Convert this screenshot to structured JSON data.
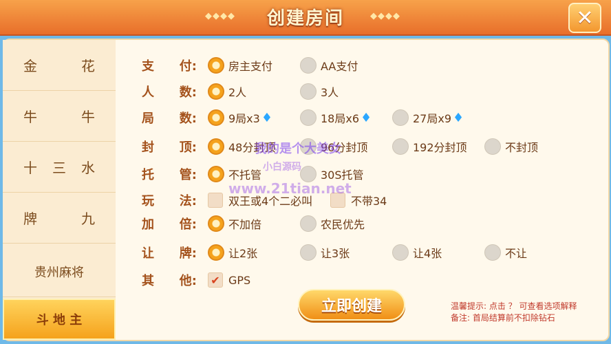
{
  "header": {
    "title": "创建房间",
    "deco_left": "◆◆◆◆",
    "deco_right": "◆◆◆◆",
    "close_glyph": "✕"
  },
  "sidebar": {
    "items": [
      {
        "a": "金",
        "b": "花"
      },
      {
        "a": "牛",
        "b": "牛"
      },
      {
        "a": "十",
        "b": "三",
        "c": "水"
      },
      {
        "a": "牌",
        "b": "九"
      },
      {
        "label": "贵州麻将"
      },
      {
        "label": "斗 地 主",
        "active": true
      }
    ]
  },
  "rows": [
    {
      "l1": "支",
      "l2": "付:",
      "options": [
        "房主支付",
        "AA支付"
      ],
      "selected": 0
    },
    {
      "l1": "人",
      "l2": "数:",
      "options": [
        "2人",
        "3人"
      ],
      "selected": 0
    },
    {
      "l1": "局",
      "l2": "数:",
      "options": [
        "9局x3",
        "18局x6",
        "27局x9"
      ],
      "selected": 0
    },
    {
      "l1": "封",
      "l2": "顶:",
      "options": [
        "48分封顶",
        "96分封顶",
        "192分封顶",
        "不封顶"
      ],
      "selected": 0
    },
    {
      "l1": "托",
      "l2": "管:",
      "options": [
        "不托管",
        "30S托管"
      ],
      "selected": 0
    },
    {
      "l1": "玩",
      "l2": "法:",
      "options": [
        "双王或4个二必叫",
        "不带34"
      ]
    },
    {
      "l1": "加",
      "l2": "倍:",
      "options": [
        "不加倍",
        "农民优先"
      ],
      "selected": 0
    },
    {
      "l1": "让",
      "l2": "牌:",
      "options": [
        "让2张",
        "让3张",
        "让4张",
        "不让"
      ],
      "selected": 0
    },
    {
      "l1": "其",
      "l2": "他:",
      "options": [
        "GPS"
      ]
    }
  ],
  "create_button": "立即创建",
  "tips": {
    "line1": "温馨提示: 点击 ？ 可查看选项解释",
    "line2": "备注: 首局结算前不扣除钻石"
  },
  "watermarks": [
    "小白源码",
    "www.21tian.net",
    "我的是个大美女"
  ],
  "colors": {
    "accent": "#f5a21c",
    "header": "#e86e2a",
    "label": "#a4521c",
    "diamond": "#2ba7ff"
  }
}
